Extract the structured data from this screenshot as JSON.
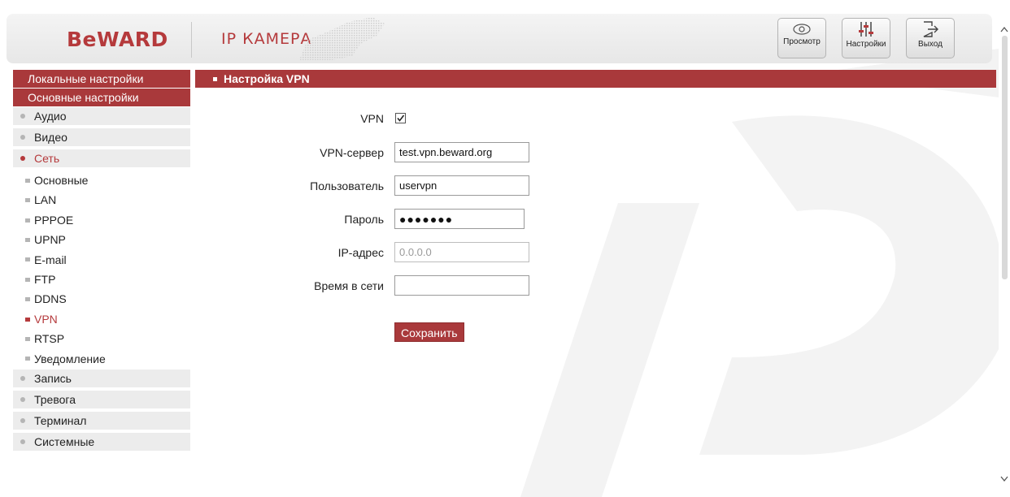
{
  "header": {
    "logo": "BeWARD",
    "product": "IP КАМЕРА",
    "buttons": [
      {
        "label": "Просмотр",
        "icon": "eye-icon"
      },
      {
        "label": "Настройки",
        "icon": "sliders-icon"
      },
      {
        "label": "Выход",
        "icon": "logout-icon"
      }
    ]
  },
  "sidebar": {
    "local_settings": "Локальные настройки",
    "main_settings": "Основные настройки",
    "groups_top": [
      "Аудио",
      "Видео",
      "Сеть"
    ],
    "network_subitems": [
      "Основные",
      "LAN",
      "PPPOE",
      "UPNP",
      "E-mail",
      "FTP",
      "DDNS",
      "VPN",
      "RTSP",
      "Уведомление"
    ],
    "groups_bottom": [
      "Запись",
      "Тревога",
      "Терминал",
      "Системные"
    ],
    "active_group": "Сеть",
    "active_subitem": "VPN"
  },
  "section": {
    "title": "Настройка VPN"
  },
  "form": {
    "vpn_label": "VPN",
    "vpn_enabled": true,
    "server_label": "VPN-сервер",
    "server_value": "test.vpn.beward.org",
    "user_label": "Пользователь",
    "user_value": "uservpn",
    "password_label": "Пароль",
    "password_value": "●●●●●●●",
    "ip_label": "IP-адрес",
    "ip_value": "0.0.0.0",
    "time_label": "Время в сети",
    "time_value": "",
    "save_label": "Сохранить"
  },
  "colors": {
    "accent": "#a9393b",
    "brand": "#b53a3c"
  }
}
